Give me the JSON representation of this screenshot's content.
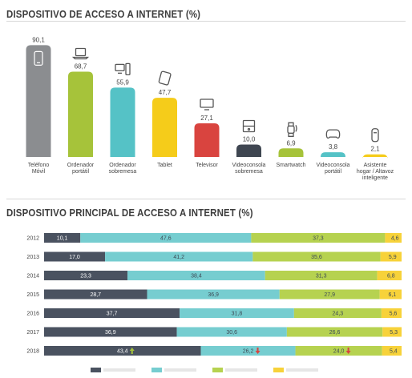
{
  "chart_data": [
    {
      "type": "bar",
      "title": "DISPOSITIVO DE ACCESO A INTERNET (%)",
      "categories": [
        "Teléfono Móvil",
        "Ordenador portátil",
        "Ordenador sobremesa",
        "Tablet",
        "Televisor",
        "Videoconsola sobremesa",
        "Smartwatch",
        "Videoconsola portátil",
        "Asistente hogar / Altavoz inteligente"
      ],
      "category_lines": [
        [
          "Teléfono",
          "Móvil"
        ],
        [
          "Ordenador",
          "portátil"
        ],
        [
          "Ordenador",
          "sobremesa"
        ],
        [
          "Tablet"
        ],
        [
          "Televisor"
        ],
        [
          "Videoconsola",
          "sobremesa"
        ],
        [
          "Smartwatch"
        ],
        [
          "Videoconsola",
          "portátil"
        ],
        [
          "Asistente",
          "hogar / Altavoz",
          "inteligente"
        ]
      ],
      "values": [
        90.1,
        68.7,
        55.9,
        47.7,
        27.1,
        10.0,
        6.9,
        3.8,
        2.1
      ],
      "value_labels": [
        "90,1",
        "68,7",
        "55,9",
        "47,7",
        "27,1",
        "10,0",
        "6,9",
        "3,8",
        "2,1"
      ],
      "colors": [
        "#8b8d90",
        "#a6c33a",
        "#55c2c6",
        "#f5cc1a",
        "#d9443f",
        "#3f4651",
        "#a6c33a",
        "#55c2c6",
        "#f5cc1a"
      ],
      "icons": [
        "smartphone-icon",
        "laptop-icon",
        "desktop-computer-icon",
        "tablet-icon",
        "television-icon",
        "game-console-icon",
        "smartwatch-icon",
        "gamepad-icon",
        "smart-speaker-icon"
      ],
      "ylim": [
        0,
        100
      ]
    },
    {
      "type": "bar",
      "orientation": "horizontal",
      "stacked": true,
      "normalized": true,
      "title": "DISPOSITIVO PRINCIPAL DE ACCESO A INTERNET (%)",
      "categories": [
        "2012",
        "2013",
        "2014",
        "2015",
        "2016",
        "2017",
        "2018"
      ],
      "series": [
        {
          "color": "#4a5260",
          "values": [
            10.1,
            17.0,
            23.3,
            28.7,
            37.7,
            36.9,
            43.4
          ],
          "labels": [
            "10,1",
            "17,0",
            "23,3",
            "28,7",
            "37,7",
            "36,9",
            "43,4"
          ]
        },
        {
          "color": "#76cdd0",
          "values": [
            47.6,
            41.2,
            38.4,
            36.9,
            31.8,
            30.6,
            26.2
          ],
          "labels": [
            "47,6",
            "41,2",
            "38,4",
            "36,9",
            "31,8",
            "30,6",
            "26,2"
          ]
        },
        {
          "color": "#b6d250",
          "values": [
            37.3,
            35.6,
            31.3,
            27.9,
            24.3,
            26.6,
            24.0
          ],
          "labels": [
            "37,3",
            "35,6",
            "31,3",
            "27,9",
            "24,3",
            "26,6",
            "24,0"
          ]
        },
        {
          "color": "#f7d23a",
          "values": [
            4.6,
            5.9,
            6.8,
            6.1,
            5.6,
            5.3,
            5.4
          ],
          "labels": [
            "4,6",
            "5,9",
            "6,8",
            "6,1",
            "5,6",
            "5,3",
            "5,4"
          ]
        }
      ],
      "annotations_2018": [
        {
          "series": 0,
          "direction": "up",
          "color": "#a6c33a"
        },
        {
          "series": 1,
          "direction": "down",
          "color": "#d9443f"
        },
        {
          "series": 2,
          "direction": "down",
          "color": "#d9443f"
        }
      ],
      "legend": {
        "position": "bottom",
        "labels_legible": false
      }
    }
  ]
}
